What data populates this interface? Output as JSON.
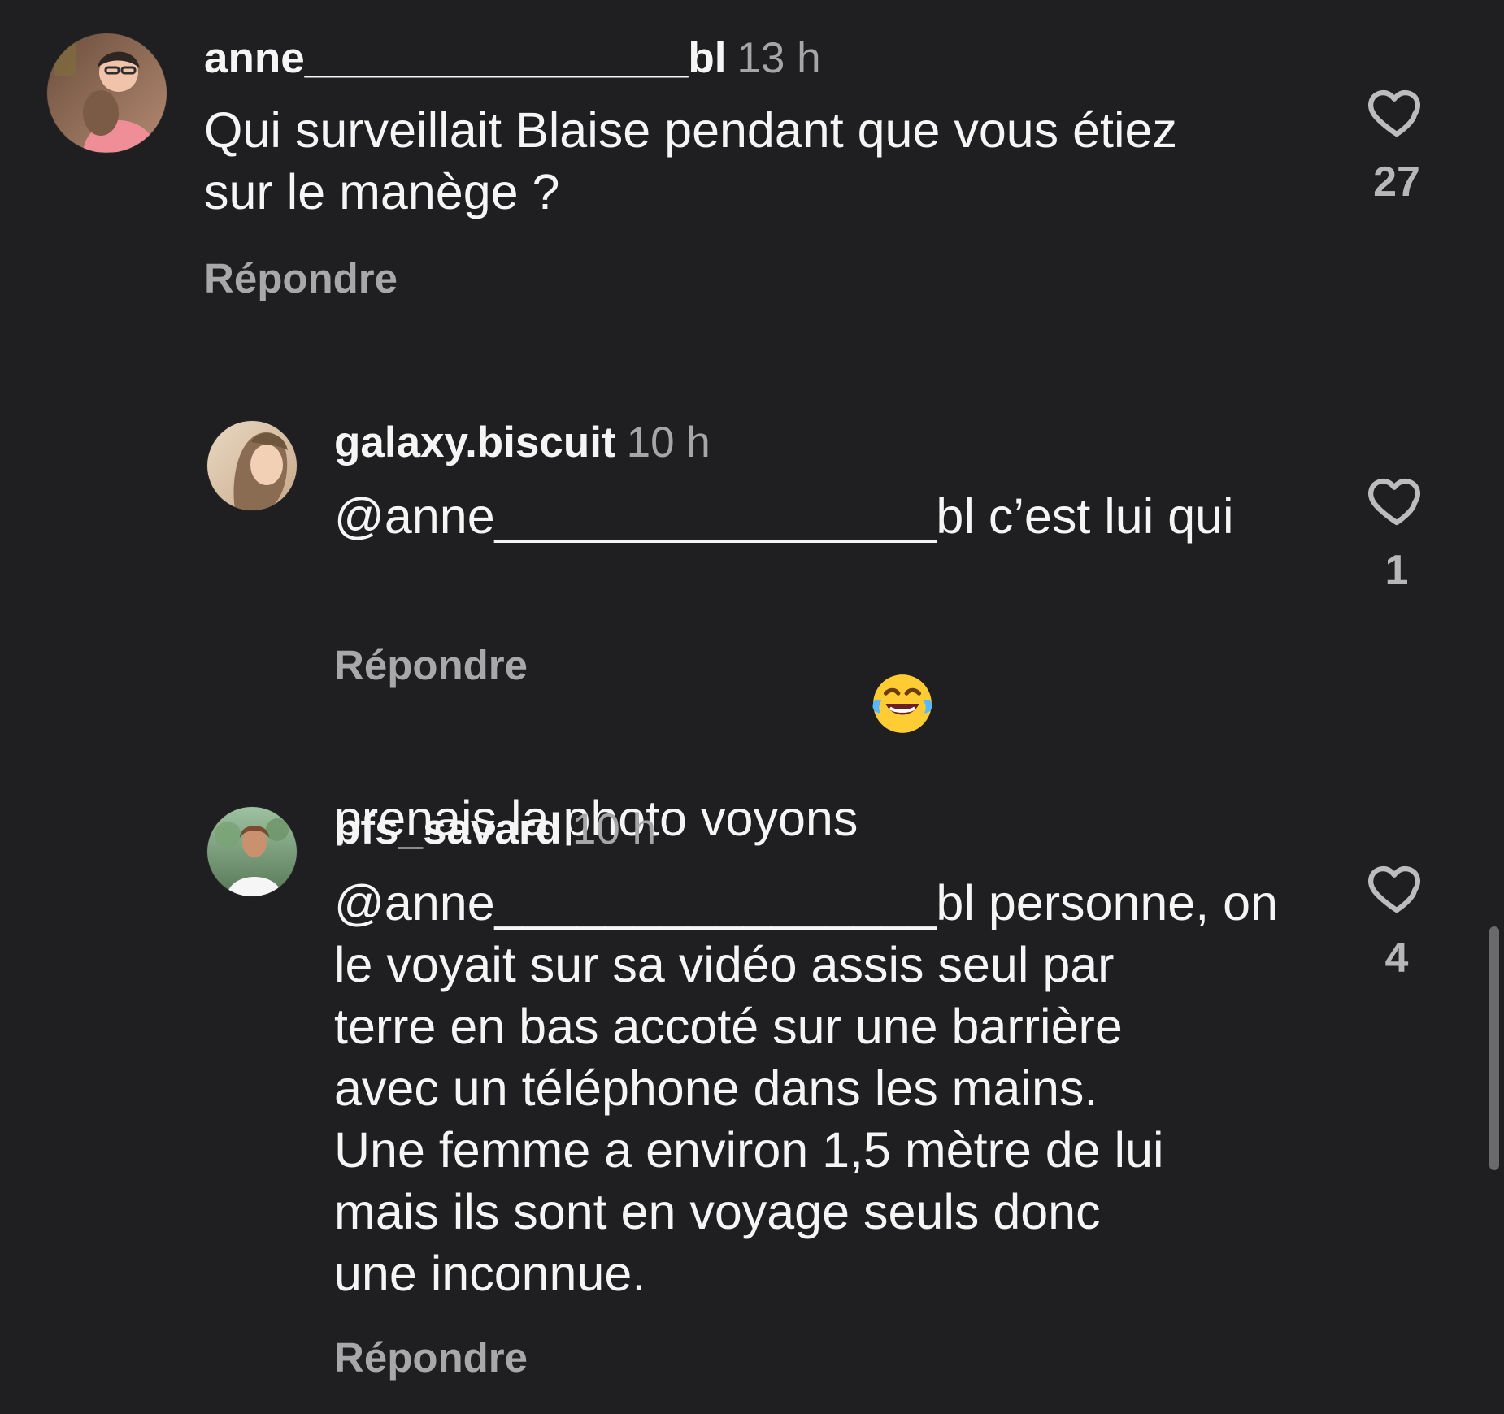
{
  "colors": {
    "background": "#1f1f21",
    "text_primary": "#f5f5f5",
    "text_secondary": "#a6a6a8",
    "like_outline": "#bcbcbe",
    "scrollbar": "#6f6f72"
  },
  "icons": {
    "like": "heart-outline-icon",
    "reaction": "laughing-crying-emoji-icon"
  },
  "comments": [
    {
      "username": "anne________________bl",
      "time": "13 h",
      "text": "Qui surveillait Blaise pendant que vous étiez\nsur le manège ?",
      "reply_label": "Répondre",
      "like_count": "27"
    },
    {
      "username": "galaxy.biscuit",
      "time": "10 h",
      "text": "@anne________________bl c’est lui qui\nprenais la photo voyons",
      "emoji": "😂",
      "reply_label": "Répondre",
      "like_count": "1"
    },
    {
      "username": "bfs_savard",
      "time": "10 h",
      "text": "@anne________________bl personne, on\nle voyait sur sa vidéo assis seul par\nterre en bas accoté sur une barrière\navec un téléphone dans les mains.\nUne femme a environ 1,5 mètre de lui\nmais ils sont en voyage seuls donc\nune inconnue.",
      "reply_label": "Répondre",
      "like_count": "4"
    }
  ]
}
